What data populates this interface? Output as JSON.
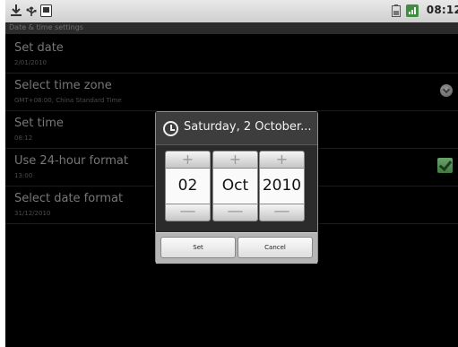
{
  "status_bar": {
    "icons": [
      "download-icon",
      "usb-icon",
      "app-notification-icon",
      "battery-icon",
      "signal-icon"
    ],
    "time": "08:12"
  },
  "screen_title": "Date & time settings",
  "settings": [
    {
      "title": "Set date",
      "summary": "2/01/2010"
    },
    {
      "title": "Select time zone",
      "summary": "GMT+08:00, China Standard Time"
    },
    {
      "title": "Set time",
      "summary": "08:12"
    },
    {
      "title": "Use 24-hour format",
      "summary": "13:00",
      "checked": true
    },
    {
      "title": "Select date format",
      "summary": "31/12/2010"
    }
  ],
  "dialog": {
    "title": "Saturday, 2 October...",
    "icon": "clock-icon",
    "day": "02",
    "month": "Oct",
    "year": "2010",
    "increment_symbol": "+",
    "decrement_symbol": "—",
    "set_label": "Set",
    "cancel_label": "Cancel"
  },
  "colors": {
    "accent_check": "#4f8f4f",
    "background": "#000000"
  }
}
